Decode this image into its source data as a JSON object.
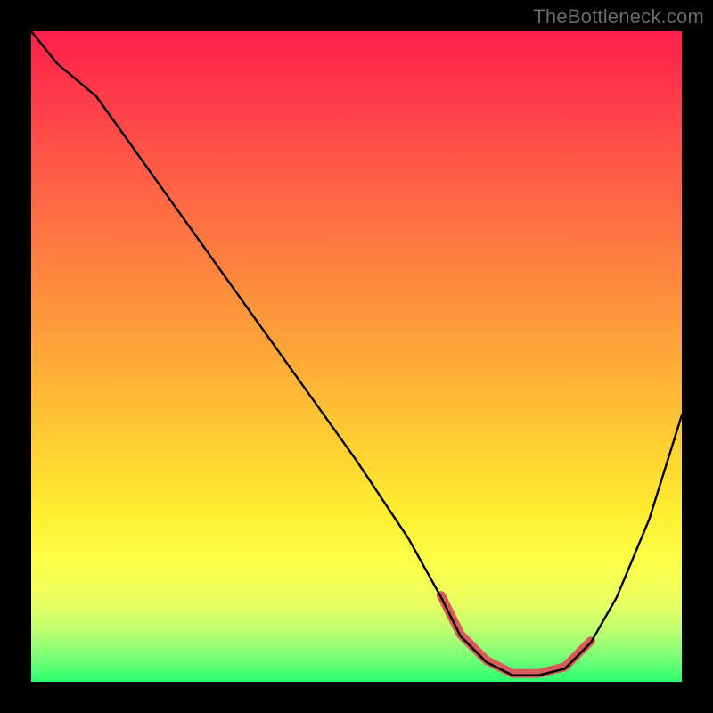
{
  "watermark": "TheBottleneck.com",
  "colors": {
    "frame_bg": "#000000",
    "curve": "#000000",
    "highlight_segment": "#d95a5a",
    "gradient_stops": [
      "#ff1f4b",
      "#ff3b4a",
      "#ff5d46",
      "#ff8040",
      "#ffa838",
      "#ffce32",
      "#ffee30",
      "#fbff4a",
      "#e9ff62",
      "#bfff6e",
      "#7dff77",
      "#2bff6f"
    ]
  },
  "chart_data": {
    "type": "line",
    "title": "",
    "xlabel": "",
    "ylabel": "",
    "xlim": [
      0,
      100
    ],
    "ylim": [
      0,
      100
    ],
    "grid": false,
    "legend": false,
    "series": [
      {
        "name": "curve",
        "x": [
          0,
          4,
          10,
          20,
          30,
          40,
          50,
          58,
          63,
          66,
          70,
          74,
          78,
          82,
          86,
          90,
          95,
          100
        ],
        "y": [
          100,
          95,
          90,
          76,
          62,
          48,
          34,
          22,
          13,
          7,
          3,
          1,
          1,
          2,
          6,
          13,
          25,
          41
        ]
      }
    ],
    "highlight_range_x": [
      63,
      86
    ],
    "notes": "Y values estimated from vertical position of black curve relative to gradient plot area; no axis ticks or labels visible. Highlighted salmon segment spans approximately x=63..86 near the valley floor."
  }
}
